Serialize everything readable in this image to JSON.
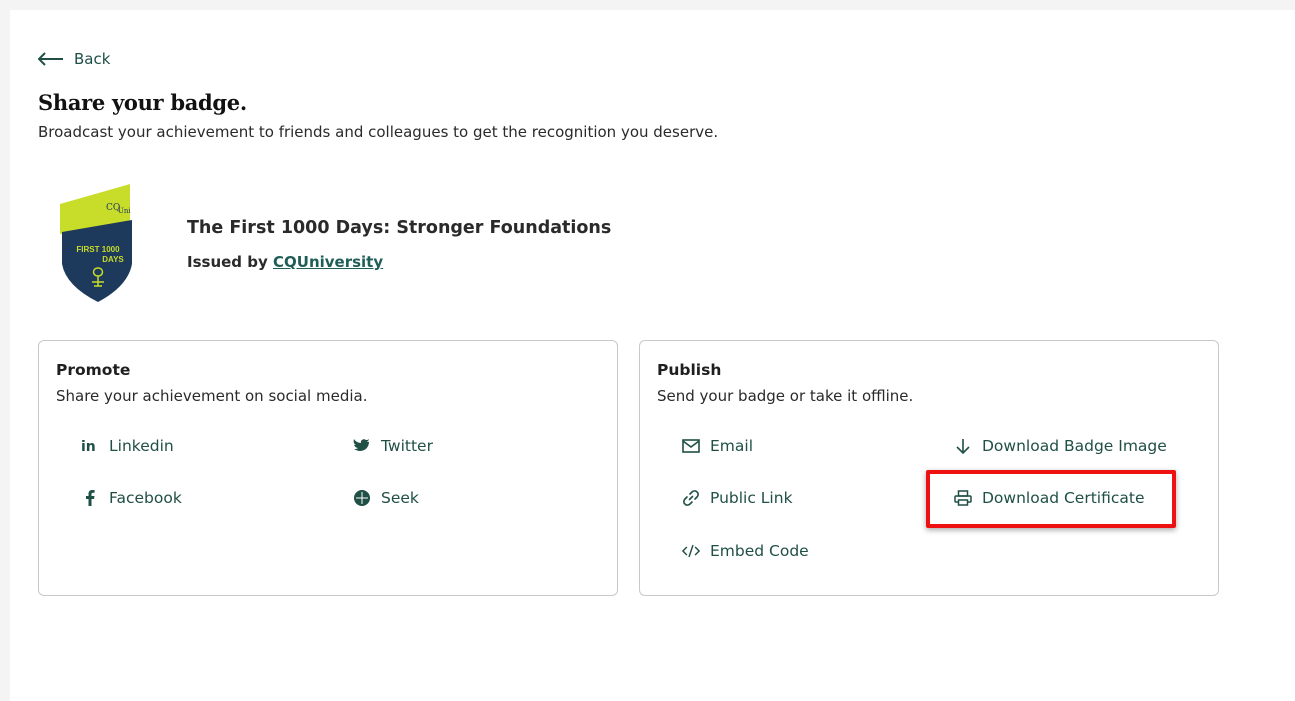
{
  "back_label": "Back",
  "page_title": "Share your badge.",
  "page_subtitle": "Broadcast your achievement to friends and colleagues to get the recognition you deserve.",
  "badge": {
    "name": "The First 1000 Days: Stronger Foundations",
    "issued_prefix": "Issued by",
    "issuer": "CQUniversity",
    "logo_text_top": "CQUni",
    "logo_text_line1": "FIRST 1000",
    "logo_text_line2": "DAYS"
  },
  "promote": {
    "title": "Promote",
    "description": "Share your achievement on social media.",
    "options": {
      "linkedin": "Linkedin",
      "twitter": "Twitter",
      "facebook": "Facebook",
      "seek": "Seek"
    }
  },
  "publish": {
    "title": "Publish",
    "description": "Send your badge or take it offline.",
    "options": {
      "email": "Email",
      "download_image": "Download Badge Image",
      "public_link": "Public Link",
      "download_certificate": "Download Certificate",
      "embed_code": "Embed Code"
    }
  },
  "colors": {
    "accent": "#1f4f45",
    "link": "#1f5e57",
    "highlight": "#ee1111",
    "badge_green": "#c8dc2a",
    "badge_navy": "#1d3a5c"
  }
}
